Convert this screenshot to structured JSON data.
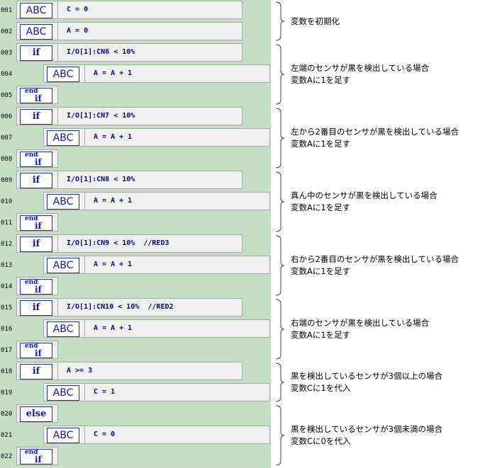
{
  "rows": [
    {
      "n": "001",
      "kind": "abc",
      "label": "ABC",
      "code": "C = 0",
      "indent": 0
    },
    {
      "n": "002",
      "kind": "abc",
      "label": "ABC",
      "code": "A = 0",
      "indent": 0
    },
    {
      "n": "003",
      "kind": "if",
      "label": "if",
      "code": "I/O[1]:CN6 < 10%",
      "indent": 0
    },
    {
      "n": "004",
      "kind": "abc",
      "label": "ABC",
      "code": "A = A + 1",
      "indent": 1
    },
    {
      "n": "005",
      "kind": "endif",
      "label_top": "end",
      "label_bottom": "if",
      "indent": 0
    },
    {
      "n": "006",
      "kind": "if",
      "label": "if",
      "code": "I/O[1]:CN7 < 10%",
      "indent": 0
    },
    {
      "n": "007",
      "kind": "abc",
      "label": "ABC",
      "code": "A = A + 1",
      "indent": 1
    },
    {
      "n": "008",
      "kind": "endif",
      "label_top": "end",
      "label_bottom": "if",
      "indent": 0
    },
    {
      "n": "009",
      "kind": "if",
      "label": "if",
      "code": "I/O[1]:CN8 < 10%",
      "indent": 0
    },
    {
      "n": "010",
      "kind": "abc",
      "label": "ABC",
      "code": "A = A + 1",
      "indent": 1
    },
    {
      "n": "011",
      "kind": "endif",
      "label_top": "end",
      "label_bottom": "if",
      "indent": 0
    },
    {
      "n": "012",
      "kind": "if",
      "label": "if",
      "code": "I/O[1]:CN9 < 10%  //RED3",
      "indent": 0
    },
    {
      "n": "013",
      "kind": "abc",
      "label": "ABC",
      "code": "A = A + 1",
      "indent": 1
    },
    {
      "n": "014",
      "kind": "endif",
      "label_top": "end",
      "label_bottom": "if",
      "indent": 0
    },
    {
      "n": "015",
      "kind": "if",
      "label": "if",
      "code": "I/O[1]:CN10 < 10%  //RED2",
      "indent": 0
    },
    {
      "n": "016",
      "kind": "abc",
      "label": "ABC",
      "code": "A = A + 1",
      "indent": 1
    },
    {
      "n": "017",
      "kind": "endif",
      "label_top": "end",
      "label_bottom": "if",
      "indent": 0
    },
    {
      "n": "018",
      "kind": "if",
      "label": "if",
      "code": "A >= 3",
      "indent": 0
    },
    {
      "n": "019",
      "kind": "abc",
      "label": "ABC",
      "code": "C = 1",
      "indent": 1
    },
    {
      "n": "020",
      "kind": "else",
      "label": "else",
      "indent": 0
    },
    {
      "n": "021",
      "kind": "abc",
      "label": "ABC",
      "code": "C = 0",
      "indent": 1
    },
    {
      "n": "022",
      "kind": "endif",
      "label_top": "end",
      "label_bottom": "if",
      "indent": 0
    }
  ],
  "annotations": [
    {
      "lines": [
        "変数を初期化"
      ]
    },
    {
      "lines": [
        "左端のセンサが黒を検出している場合",
        "変数Aに1を足す"
      ]
    },
    {
      "lines": [
        "左から2番目のセンサが黒を検出している場合",
        "変数Aに1を足す"
      ]
    },
    {
      "lines": [
        "真ん中のセンサが黒を検出している場合",
        "変数Aに1を足す"
      ]
    },
    {
      "lines": [
        "右から2番目のセンサが黒を検出している場合",
        "変数Aに1を足す"
      ]
    },
    {
      "lines": [
        "右端のセンサが黒を検出している場合",
        "変数Aに1を足す"
      ]
    },
    {
      "lines": [
        "黒を検出しているセンサが3個以上の場合",
        "変数Cに1を代入"
      ]
    },
    {
      "lines": [
        "黒を検出しているセンサが3個未満の場合",
        "変数Cに0を代入"
      ]
    }
  ],
  "colors": {
    "editor_bg": "#c5dfc5",
    "keyword": "#1515b5",
    "code_text": "#0000a5",
    "box_bg": "#f0f0f0"
  }
}
